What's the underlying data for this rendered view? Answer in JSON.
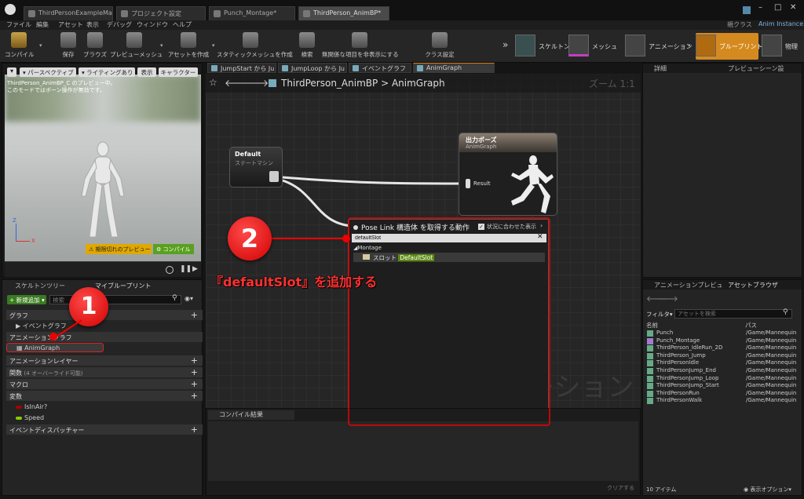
{
  "tabs": [
    {
      "label": "ThirdPersonExampleMap"
    },
    {
      "label": "プロジェクト設定"
    },
    {
      "label": "Punch_Montage*"
    },
    {
      "label": "ThirdPerson_AnimBP*"
    }
  ],
  "parent_class": {
    "label": "親クラス",
    "value": "Anim Instance"
  },
  "menu": [
    "ファイル",
    "編集",
    "アセット",
    "表示",
    "デバッグ",
    "ウィンドウ",
    "ヘルプ"
  ],
  "toolbar": {
    "compile": "コンパイル",
    "save": "保存",
    "browse": "ブラウズ",
    "preview_mesh": "プレビューメッシュ",
    "create_asset": "アセットを作成",
    "static_mesh": "スタティックメッシュを作成",
    "search": "検索",
    "hide_unrelated": "無関係な項目を非表示にする",
    "class_settings": "クラス設定"
  },
  "modes": {
    "skeleton": "スケルトン",
    "mesh": "メッシュ",
    "animation": "アニメーション",
    "blueprint": "ブループリント",
    "physics": "物理"
  },
  "viewport": {
    "perspective": "パースペクティブ",
    "lighting": "ライティングあり",
    "show": "表示",
    "character": "キャラクター",
    "info1": "ThirdPerson_AnimBP_C のプレビュー中。",
    "info2": "このモードではボーン操作が無効です。",
    "preview_badge": "期限切れのプレビュー",
    "compile_badge": "コンパイル"
  },
  "mybp": {
    "tab_skeleton": "スケルトンツリー",
    "tab_mybp": "マイブループリント",
    "add_new": "新規追加",
    "search_placeholder": "検索",
    "graph": "グラフ",
    "event_graph": "イベントグラフ",
    "anim_graph_sec": "アニメーショングラフ",
    "anim_graph": "AnimGraph",
    "anim_layer": "アニメーションレイヤー",
    "functions": "関数",
    "functions_note": "(4 オーバーライド可能)",
    "macros": "マクロ",
    "variables": "変数",
    "var1": "IsInAir?",
    "var2": "Speed",
    "dispatchers": "イベントディスパッチャー"
  },
  "graph_tabs": [
    {
      "label": "JumpStart から Ju"
    },
    {
      "label": "JumpLoop から Ju"
    },
    {
      "label": "イベントグラフ"
    },
    {
      "label": "AnimGraph"
    }
  ],
  "graph": {
    "breadcrumb_bp": "ThirdPerson_AnimBP",
    "breadcrumb_graph": "AnimGraph",
    "zoom": "ズーム 1:1",
    "watermark": "ーション",
    "default_title": "Default",
    "default_sub": "ステートマシン",
    "output_title": "出力ポーズ",
    "output_sub": "AnimGraph",
    "result_label": "Result",
    "menu_title": "Pose Link 構造体 を取得する動作",
    "context": "状況に合わせた表示",
    "search_value": "defaultSlot",
    "category": "Montage",
    "slot_label": "スロット",
    "slot_value": "DefaultSlot"
  },
  "compile_results": {
    "tab": "コンパイル結果",
    "clear": "クリアする"
  },
  "details": {
    "tab": "詳細",
    "preview_scene": "プレビューシーン設"
  },
  "asset_browser": {
    "tab_preview": "アニメーションプレビュ",
    "tab_browser": "アセットブラウザ",
    "filter": "フィルタ",
    "search_placeholder": "アセットを検索",
    "col_name": "名前",
    "col_path": "パス",
    "items": [
      {
        "name": "Punch",
        "path": "/Game/Mannequin"
      },
      {
        "name": "Punch_Montage",
        "path": "/Game/Mannequin"
      },
      {
        "name": "ThirdPerson_IdleRun_2D",
        "path": "/Game/Mannequin"
      },
      {
        "name": "ThirdPerson_Jump",
        "path": "/Game/Mannequin"
      },
      {
        "name": "ThirdPersonIdle",
        "path": "/Game/Mannequin"
      },
      {
        "name": "ThirdPersonJump_End",
        "path": "/Game/Mannequin"
      },
      {
        "name": "ThirdPersonJump_Loop",
        "path": "/Game/Mannequin"
      },
      {
        "name": "ThirdPersonJump_Start",
        "path": "/Game/Mannequin"
      },
      {
        "name": "ThirdPersonRun",
        "path": "/Game/Mannequin"
      },
      {
        "name": "ThirdPersonWalk",
        "path": "/Game/Mannequin"
      }
    ],
    "count": "10 アイテム",
    "view_options": "表示オプション"
  },
  "annotations": {
    "marker1": "1",
    "marker2": "2",
    "caption": "『defaultSlot』を追加する"
  }
}
